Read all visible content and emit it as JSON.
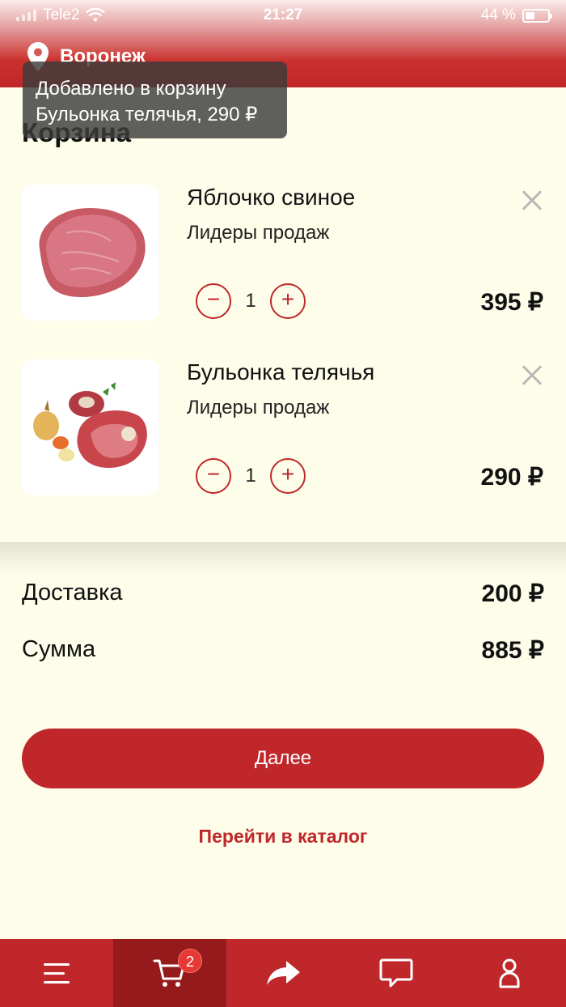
{
  "status_bar": {
    "carrier": "Tele2",
    "time": "21:27",
    "battery": "44 %"
  },
  "header": {
    "city": "Воронеж"
  },
  "toast": {
    "line1": "Добавлено в корзину",
    "line2": "Бульонка телячья, 290 ₽"
  },
  "page": {
    "title": "Корзина"
  },
  "cart": {
    "items": [
      {
        "name": "Яблочко свиное",
        "category": "Лидеры продаж",
        "quantity": "1",
        "price": "395 ₽",
        "minus": "−",
        "plus": "+"
      },
      {
        "name": "Бульонка телячья",
        "category": "Лидеры продаж",
        "quantity": "1",
        "price": "290 ₽",
        "minus": "−",
        "plus": "+"
      }
    ]
  },
  "summary": {
    "delivery_label": "Доставка",
    "delivery_value": "200 ₽",
    "total_label": "Сумма",
    "total_value": "885 ₽"
  },
  "actions": {
    "next_label": "Далее",
    "catalog_link": "Перейти в каталог"
  },
  "tabbar": {
    "tabs": [
      {
        "icon": "menu-icon"
      },
      {
        "icon": "cart-icon",
        "badge": "2",
        "active": true
      },
      {
        "icon": "share-icon"
      },
      {
        "icon": "chat-icon"
      },
      {
        "icon": "profile-icon"
      }
    ]
  },
  "colors": {
    "brand": "#c0272a",
    "brand_dark": "#951a1c",
    "background": "#fdfdea"
  }
}
